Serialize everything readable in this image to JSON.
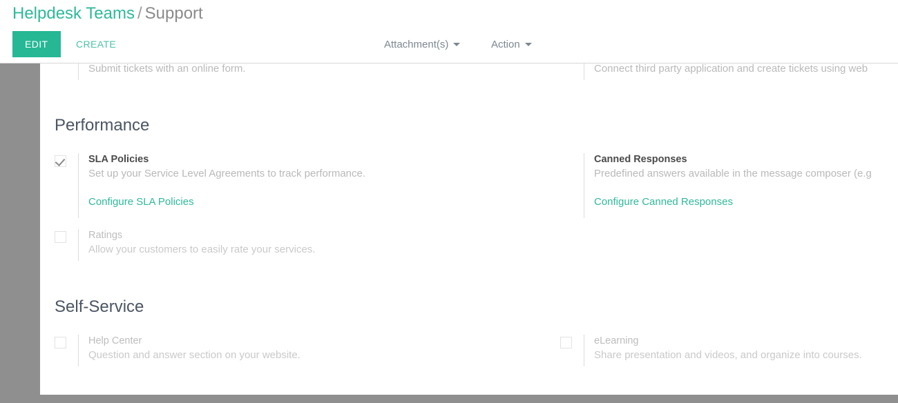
{
  "header": {
    "breadcrumb": {
      "root": "Helpdesk Teams",
      "separator": "/",
      "leaf": "Support"
    },
    "buttons": {
      "edit": "EDIT",
      "create": "CREATE"
    },
    "menus": [
      {
        "label": "Attachment(s)",
        "icon": "chevron-down-icon"
      },
      {
        "label": "Action",
        "icon": "chevron-down-icon"
      }
    ]
  },
  "colors": {
    "accent": "#26b795",
    "link": "#2fb99a",
    "muted": "#b9b9b9",
    "heading": "#4b5563",
    "backdrop": "#8f8f8f"
  },
  "content": {
    "clipped_row": {
      "left": {
        "description": "Submit tickets with an online form."
      },
      "right": {
        "description": "Connect third party application and create tickets using web"
      }
    },
    "sections": [
      {
        "title": "Performance",
        "rows": [
          {
            "checkbox": "checked",
            "title": "SLA Policies",
            "description": "Set up your Service Level Agreements to track performance.",
            "link": "Configure SLA Policies"
          },
          {
            "checkbox": "hidden",
            "title": "Canned Responses",
            "description": "Predefined answers available in the message composer (e.g",
            "link": "Configure Canned Responses"
          },
          {
            "checkbox": "unchecked",
            "title": "Ratings",
            "description": "Allow your customers to easily rate your services.",
            "link": ""
          }
        ]
      },
      {
        "title": "Self-Service",
        "rows": [
          {
            "checkbox": "unchecked",
            "title": "Help Center",
            "description": "Question and answer section on your website.",
            "link": ""
          },
          {
            "checkbox": "unchecked",
            "title": "eLearning",
            "description": "Share presentation and videos, and organize into courses.",
            "link": ""
          }
        ]
      }
    ]
  }
}
